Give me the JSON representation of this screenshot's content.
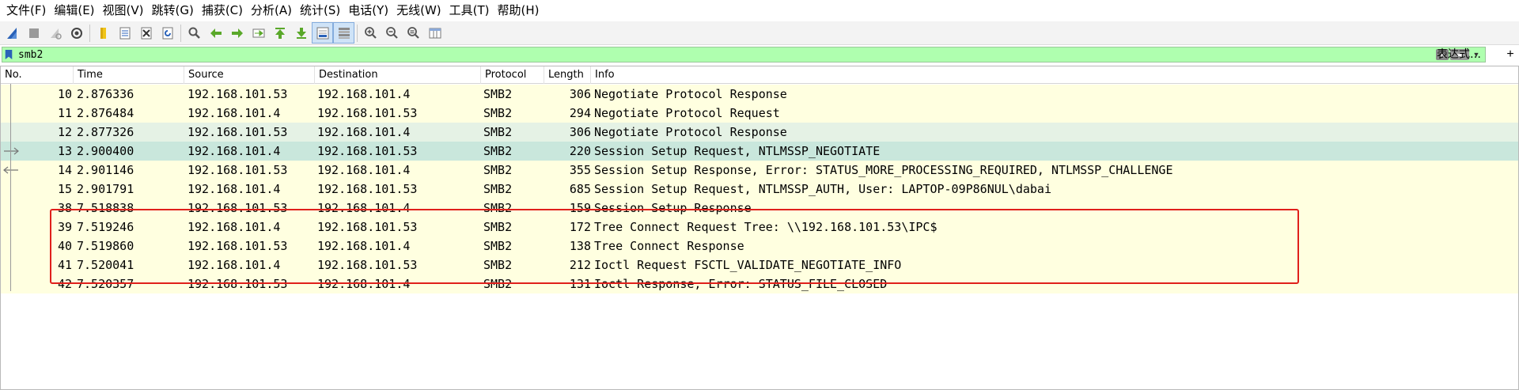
{
  "menu": {
    "items": [
      "文件(F)",
      "编辑(E)",
      "视图(V)",
      "跳转(G)",
      "捕获(C)",
      "分析(A)",
      "统计(S)",
      "电话(Y)",
      "无线(W)",
      "工具(T)",
      "帮助(H)"
    ]
  },
  "toolbar": {
    "buttons": [
      "shark-fin-start-icon",
      "stop-icon",
      "restart-icon",
      "capture-options-icon",
      "open-icon",
      "save-icon",
      "close-icon",
      "reload-icon",
      "find-icon",
      "back-icon",
      "forward-icon",
      "go-to-packet-icon",
      "first-packet-icon",
      "last-packet-icon",
      "autoscroll-icon",
      "colorize-icon",
      "zoom-in-icon",
      "zoom-out-icon",
      "normal-size-icon",
      "resize-columns-icon"
    ]
  },
  "filter": {
    "value": "smb2",
    "expression_label": "表达式…",
    "add_label": "+"
  },
  "columns": {
    "no": "No.",
    "time": "Time",
    "source": "Source",
    "destination": "Destination",
    "protocol": "Protocol",
    "length": "Length",
    "info": "Info"
  },
  "packets": [
    {
      "no": "10",
      "time": "2.876336",
      "src": "192.168.101.53",
      "dst": "192.168.101.4",
      "proto": "SMB2",
      "len": "306",
      "info": "Negotiate Protocol Response"
    },
    {
      "no": "11",
      "time": "2.876484",
      "src": "192.168.101.4",
      "dst": "192.168.101.53",
      "proto": "SMB2",
      "len": "294",
      "info": "Negotiate Protocol Request"
    },
    {
      "no": "12",
      "time": "2.877326",
      "src": "192.168.101.53",
      "dst": "192.168.101.4",
      "proto": "SMB2",
      "len": "306",
      "info": "Negotiate Protocol Response"
    },
    {
      "no": "13",
      "time": "2.900400",
      "src": "192.168.101.4",
      "dst": "192.168.101.53",
      "proto": "SMB2",
      "len": "220",
      "info": "Session Setup Request, NTLMSSP_NEGOTIATE"
    },
    {
      "no": "14",
      "time": "2.901146",
      "src": "192.168.101.53",
      "dst": "192.168.101.4",
      "proto": "SMB2",
      "len": "355",
      "info": "Session Setup Response, Error: STATUS_MORE_PROCESSING_REQUIRED, NTLMSSP_CHALLENGE"
    },
    {
      "no": "15",
      "time": "2.901791",
      "src": "192.168.101.4",
      "dst": "192.168.101.53",
      "proto": "SMB2",
      "len": "685",
      "info": "Session Setup Request, NTLMSSP_AUTH, User: LAPTOP-09P86NUL\\dabai"
    },
    {
      "no": "38",
      "time": "7.518838",
      "src": "192.168.101.53",
      "dst": "192.168.101.4",
      "proto": "SMB2",
      "len": "159",
      "info": "Session Setup Response"
    },
    {
      "no": "39",
      "time": "7.519246",
      "src": "192.168.101.4",
      "dst": "192.168.101.53",
      "proto": "SMB2",
      "len": "172",
      "info": "Tree Connect Request Tree: \\\\192.168.101.53\\IPC$"
    },
    {
      "no": "40",
      "time": "7.519860",
      "src": "192.168.101.53",
      "dst": "192.168.101.4",
      "proto": "SMB2",
      "len": "138",
      "info": "Tree Connect Response"
    },
    {
      "no": "41",
      "time": "7.520041",
      "src": "192.168.101.4",
      "dst": "192.168.101.53",
      "proto": "SMB2",
      "len": "212",
      "info": "Ioctl Request FSCTL_VALIDATE_NEGOTIATE_INFO"
    },
    {
      "no": "42",
      "time": "7.520357",
      "src": "192.168.101.53",
      "dst": "192.168.101.4",
      "proto": "SMB2",
      "len": "131",
      "info": "Ioctl Response, Error: STATUS_FILE_CLOSED"
    }
  ],
  "colors": {
    "filter_ok": "#afffaf",
    "row_default": "#ffffe0",
    "row_selected": "#c9e7dc",
    "highlight_box": "#e0201c"
  }
}
